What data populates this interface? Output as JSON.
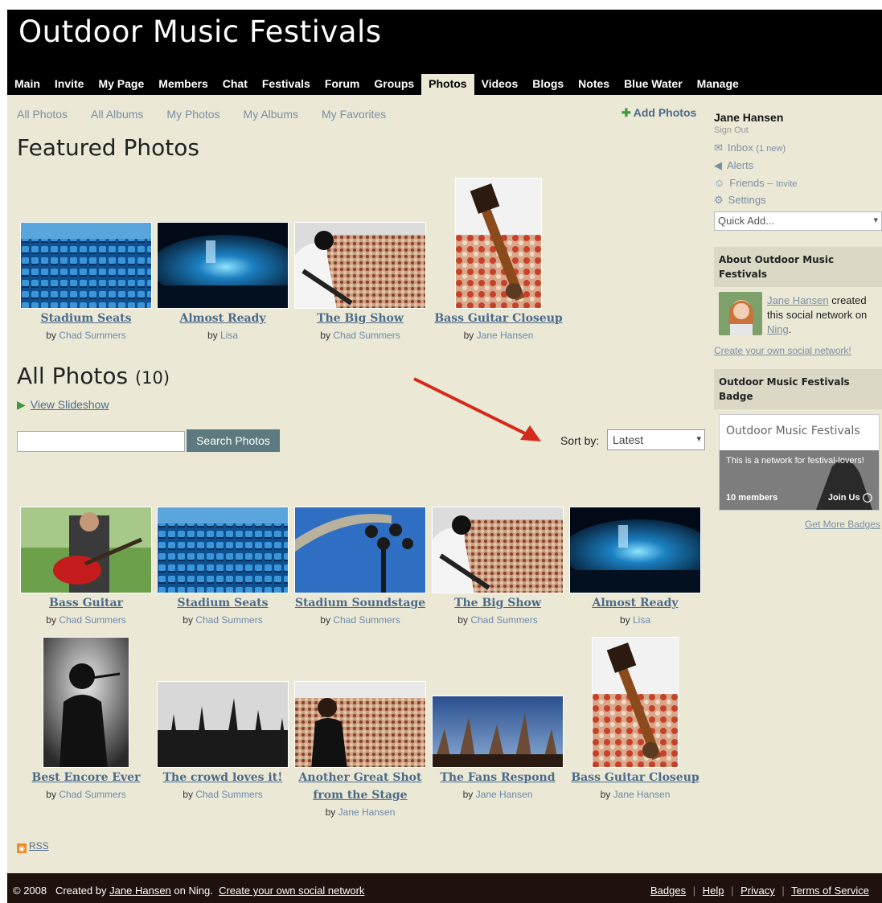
{
  "site": {
    "title": "Outdoor Music Festivals"
  },
  "nav": [
    "Main",
    "Invite",
    "My Page",
    "Members",
    "Chat",
    "Festivals",
    "Forum",
    "Groups",
    "Photos",
    "Videos",
    "Blogs",
    "Notes",
    "Blue Water",
    "Manage"
  ],
  "nav_active": "Photos",
  "subnav": [
    "All Photos",
    "All Albums",
    "My Photos",
    "My Albums",
    "My Favorites"
  ],
  "add_photos_label": "Add Photos",
  "featured": {
    "title": "Featured Photos",
    "photos": [
      {
        "title": "Stadium Seats",
        "by_prefix": "by",
        "author": "Chad Summers",
        "icon": "stadium-seats-image"
      },
      {
        "title": "Almost Ready",
        "by_prefix": "by",
        "author": "Lisa",
        "icon": "stage-light-image"
      },
      {
        "title": "The Big Show",
        "by_prefix": "by",
        "author": "Chad Summers",
        "icon": "guitarist-crowd-image"
      },
      {
        "title": "Bass Guitar Closeup",
        "by_prefix": "by",
        "author": "Jane Hansen",
        "icon": "bass-guitar-image"
      }
    ]
  },
  "all_photos": {
    "title": "All Photos",
    "count": "(10)",
    "slideshow_label": "View Slideshow",
    "search_button": "Search Photos",
    "search_value": "",
    "sort_label": "Sort by:",
    "sort_value": "Latest",
    "photos": [
      {
        "title": "Bass Guitar",
        "by_prefix": "by",
        "author": "Chad Summers",
        "icon": "red-guitar-image"
      },
      {
        "title": "Stadium Seats",
        "by_prefix": "by",
        "author": "Chad Summers",
        "icon": "stadium-seats-image"
      },
      {
        "title": "Stadium Soundstage",
        "by_prefix": "by",
        "author": "Chad Summers",
        "icon": "soundstage-lights-image"
      },
      {
        "title": "The Big Show",
        "by_prefix": "by",
        "author": "Chad Summers",
        "icon": "guitarist-crowd-image"
      },
      {
        "title": "Almost Ready",
        "by_prefix": "by",
        "author": "Lisa",
        "icon": "stage-light-image"
      },
      {
        "title": "Best Encore Ever",
        "by_prefix": "by",
        "author": "Chad Summers",
        "icon": "singer-silhouette-image"
      },
      {
        "title": "The crowd loves it!",
        "by_prefix": "by",
        "author": "Chad Summers",
        "icon": "crowd-hands-image"
      },
      {
        "title_line1": "Another Great Shot",
        "title_line2": "from the Stage",
        "by_prefix": "by",
        "author": "Jane Hansen",
        "icon": "performer-stage-image"
      },
      {
        "title": "The Fans Respond",
        "by_prefix": "by",
        "author": "Jane Hansen",
        "icon": "fans-hands-image"
      },
      {
        "title": "Bass Guitar Closeup",
        "by_prefix": "by",
        "author": "Jane Hansen",
        "icon": "bass-guitar-image"
      }
    ]
  },
  "sidebar": {
    "user_name": "Jane Hansen",
    "sign_out": "Sign Out",
    "inbox_label": "Inbox",
    "inbox_count": "(1 new)",
    "alerts_label": "Alerts",
    "friends_label": "Friends",
    "friends_sep": "–",
    "invite_label": "Invite",
    "settings_label": "Settings",
    "quick_add": "Quick Add...",
    "about_title": "About Outdoor Music Festivals",
    "about_creator": "Jane Hansen",
    "about_text": "created this social network on",
    "about_ning": "Ning",
    "about_period": ".",
    "create_link": "Create your own social network!",
    "badge_title": "Outdoor Music Festivals Badge",
    "badge_name": "Outdoor Music Festivals",
    "badge_desc": "This is a network for festival-lovers!",
    "badge_members": "10 members",
    "badge_join": "Join Us",
    "more_badges": "Get More Badges"
  },
  "rss_label": "RSS",
  "footer": {
    "copyright": "© 2008   Created by",
    "creator": "Jane Hansen",
    "on_ning": "on Ning.",
    "create_link": "Create your own social network",
    "links": [
      "Badges",
      "Help",
      "Privacy",
      "Terms of Service"
    ]
  },
  "colors": {
    "header_bg": "#000000",
    "page_bg": "#ece8d6",
    "link": "#4b6b8a",
    "footer_bg": "#1f120c",
    "annotation_arrow": "#d42a1c"
  }
}
